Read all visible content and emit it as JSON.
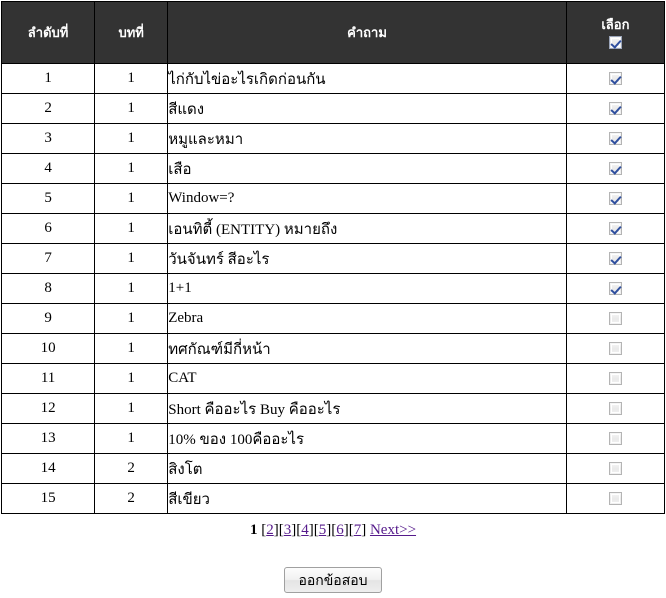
{
  "table": {
    "columns": [
      {
        "key": "seq",
        "label": "ลำดับที่"
      },
      {
        "key": "chap",
        "label": "บทที่"
      },
      {
        "key": "ques",
        "label": "คำถาม"
      },
      {
        "key": "sel",
        "label": "เลือก"
      }
    ],
    "header_select_all_checked": true,
    "rows": [
      {
        "seq": "1",
        "chap": "1",
        "ques": "ไก่กับไข่อะไรเกิดก่อนกัน",
        "checked": true
      },
      {
        "seq": "2",
        "chap": "1",
        "ques": "สีแดง",
        "checked": true
      },
      {
        "seq": "3",
        "chap": "1",
        "ques": "หมูและหมา",
        "checked": true
      },
      {
        "seq": "4",
        "chap": "1",
        "ques": "เสือ",
        "checked": true
      },
      {
        "seq": "5",
        "chap": "1",
        "ques": "Window=?",
        "checked": true
      },
      {
        "seq": "6",
        "chap": "1",
        "ques": "เอนทิตี้ (ENTITY) หมายถึง",
        "checked": true
      },
      {
        "seq": "7",
        "chap": "1",
        "ques": "วันจันทร์ สีอะไร",
        "checked": true
      },
      {
        "seq": "8",
        "chap": "1",
        "ques": "1+1",
        "checked": true
      },
      {
        "seq": "9",
        "chap": "1",
        "ques": "Zebra",
        "checked": false
      },
      {
        "seq": "10",
        "chap": "1",
        "ques": "ทศกัณฑ์มีกี่หน้า",
        "checked": false
      },
      {
        "seq": "11",
        "chap": "1",
        "ques": "CAT",
        "checked": false
      },
      {
        "seq": "12",
        "chap": "1",
        "ques": "Short คืออะไร Buy คืออะไร",
        "checked": false
      },
      {
        "seq": "13",
        "chap": "1",
        "ques": "10% ของ 100คืออะไร",
        "checked": false
      },
      {
        "seq": "14",
        "chap": "2",
        "ques": "สิงโต",
        "checked": false
      },
      {
        "seq": "15",
        "chap": "2",
        "ques": "สีเขียว",
        "checked": false
      }
    ]
  },
  "pagination": {
    "current_page": "1",
    "pages": [
      "2",
      "3",
      "4",
      "5",
      "6",
      "7"
    ],
    "next_label": "Next>>",
    "open_bracket": "[",
    "close_bracket": "]"
  },
  "actions": {
    "submit_label": "ออกข้อสอบ"
  },
  "colors": {
    "header_bg": "#333333",
    "header_text": "#ffffff",
    "border": "#000000",
    "link": "#551a8b",
    "checkmark": "#2f4f9e"
  }
}
